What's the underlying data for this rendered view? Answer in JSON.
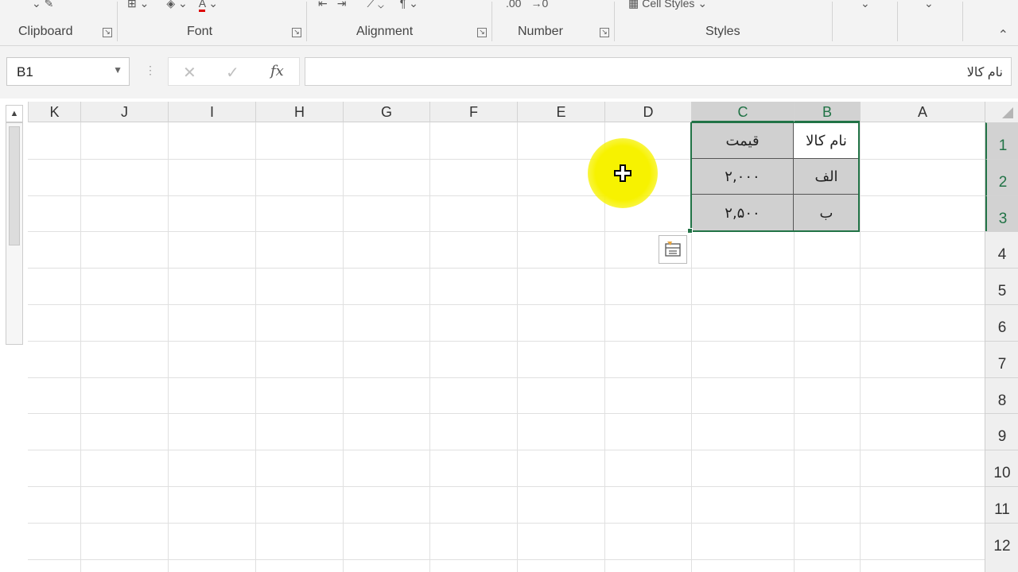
{
  "ribbon": {
    "groups": [
      {
        "id": "clipboard",
        "label": "Clipboard"
      },
      {
        "id": "font",
        "label": "Font"
      },
      {
        "id": "alignment",
        "label": "Alignment"
      },
      {
        "id": "number",
        "label": "Number"
      },
      {
        "id": "styles",
        "label": "Styles"
      }
    ],
    "cell_styles_label": "Cell Styles",
    "collapse_icon": "chevron-up-icon"
  },
  "formula_bar": {
    "name_box": "B1",
    "cancel_icon": "✕",
    "enter_icon": "✓",
    "fx_label": "fx",
    "content": "نام کالا"
  },
  "sheet": {
    "columns": [
      "K",
      "J",
      "I",
      "H",
      "G",
      "F",
      "E",
      "D",
      "C",
      "B",
      "A"
    ],
    "selected_columns": [
      "C",
      "B"
    ],
    "rows": [
      "1",
      "2",
      "3",
      "4",
      "5",
      "6",
      "7",
      "8",
      "9",
      "10",
      "11",
      "12"
    ],
    "selected_rows": [
      "1",
      "2",
      "3"
    ],
    "table": [
      {
        "b": "نام کالا",
        "c": "قیمت"
      },
      {
        "b": "الف",
        "c": "۲,۰۰۰"
      },
      {
        "b": "ب",
        "c": "۲,۵۰۰"
      }
    ]
  },
  "colors": {
    "accent": "#217346",
    "cursor_highlight": "#f7f200",
    "header_fill": "#d0d0d0"
  },
  "icons": {
    "quick_analysis": "quick-analysis-icon",
    "cursor": "crosshair-cursor-icon"
  }
}
